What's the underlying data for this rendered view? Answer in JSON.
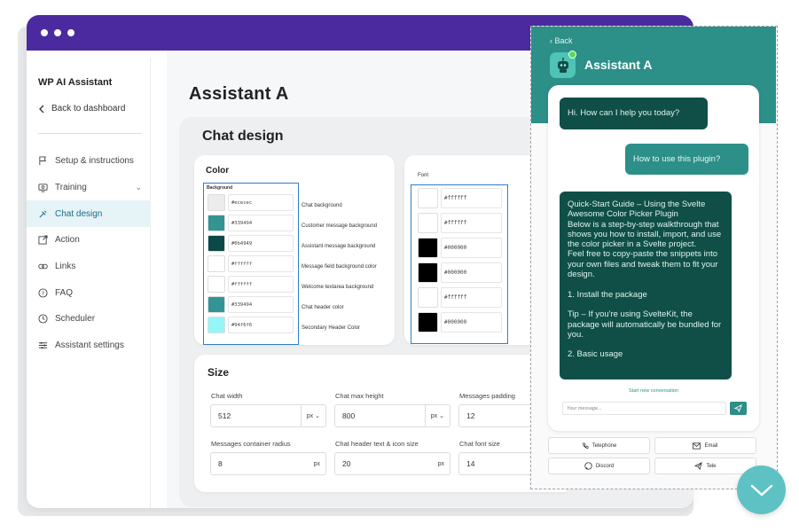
{
  "app": {
    "sidebar_title": "WP AI Assistant",
    "back_label": "Back to dashboard"
  },
  "nav": [
    {
      "label": "Setup & instructions",
      "icon": "flag-icon"
    },
    {
      "label": "Training",
      "icon": "training-icon"
    },
    {
      "label": "Chat design",
      "icon": "paint-icon",
      "active": true
    },
    {
      "label": "Action",
      "icon": "external-link-icon"
    },
    {
      "label": "Links",
      "icon": "link-icon"
    },
    {
      "label": "FAQ",
      "icon": "question-icon"
    },
    {
      "label": "Scheduler",
      "icon": "clock-icon"
    },
    {
      "label": "Assistant settings",
      "icon": "sliders-icon"
    }
  ],
  "page": {
    "title": "Assistant A",
    "section_title": "Chat design"
  },
  "color_section": {
    "label": "Color",
    "group_label": "Background",
    "rows": [
      {
        "hex": "#ececec",
        "color": "#ececec",
        "desc": "Chat background"
      },
      {
        "hex": "#339494",
        "color": "#339494",
        "desc": "Customer message background"
      },
      {
        "hex": "#0b4949",
        "color": "#0b4949",
        "desc": "Assistant message background"
      },
      {
        "hex": "#ffffff",
        "color": "#ffffff",
        "desc": "Message field background color"
      },
      {
        "hex": "#ffffff",
        "color": "#ffffff",
        "desc": "Welcome textarea background"
      },
      {
        "hex": "#339494",
        "color": "#339494",
        "desc": "Chat header color"
      },
      {
        "hex": "#94f6f6",
        "color": "#94f6f6",
        "desc": "Secondary Header Color"
      }
    ]
  },
  "font_section": {
    "label": "Font",
    "rows": [
      {
        "hex": "#ffffff",
        "color": "#ffffff"
      },
      {
        "hex": "#ffffff",
        "color": "#ffffff"
      },
      {
        "hex": "#000000",
        "color": "#000000"
      },
      {
        "hex": "#000000",
        "color": "#000000"
      },
      {
        "hex": "#ffffff",
        "color": "#ffffff"
      },
      {
        "hex": "#000000",
        "color": "#000000"
      }
    ]
  },
  "size_section": {
    "title": "Size",
    "fields": [
      {
        "label": "Chat width",
        "value": "512",
        "unit": "px",
        "dropdown": true
      },
      {
        "label": "Chat max height",
        "value": "800",
        "unit": "px",
        "dropdown": true
      },
      {
        "label": "Messages padding",
        "value": "12",
        "unit": "",
        "dropdown": false
      },
      {
        "label": "Messages container radius",
        "value": "8",
        "unit": "px",
        "dropdown": false
      },
      {
        "label": "Chat header text & icon size",
        "value": "20",
        "unit": "px",
        "dropdown": false
      },
      {
        "label": "Chat font size",
        "value": "14",
        "unit": "",
        "dropdown": false
      }
    ]
  },
  "chat": {
    "back": "‹ Back",
    "title": "Assistant A",
    "messages": [
      {
        "role": "assistant",
        "text": "Hi. How can I help you today?"
      },
      {
        "role": "user",
        "text": "How to use this plugin?"
      },
      {
        "role": "assistant",
        "text": "Quick-Start Guide – Using the Svelte Awesome Color Picker Plugin\nBelow is a step-by-step walkthrough that shows you how to install, import, and use the color picker in a Svelte project.\nFeel free to copy-paste the snippets into your own files and tweak them to fit your design.\n\n1. Install the package\n\nTip – If you're using SvelteKit, the package will automatically be bundled for you.\n\n2. Basic usage"
      }
    ],
    "start_new": "Start new conversation",
    "input_placeholder": "Your message...",
    "contacts": [
      {
        "label": "Telephone",
        "icon": "phone-icon"
      },
      {
        "label": "Email",
        "icon": "mail-icon"
      },
      {
        "label": "Discord",
        "icon": "discord-icon"
      },
      {
        "label": "Tele",
        "icon": "telegram-icon"
      }
    ]
  },
  "colors": {
    "brand_purple": "#4b2aa0",
    "teal": "#2c8f88",
    "dark_teal": "#0f4f47",
    "highlight_blue": "#2e7fc9",
    "fab": "#5ec2c4"
  }
}
